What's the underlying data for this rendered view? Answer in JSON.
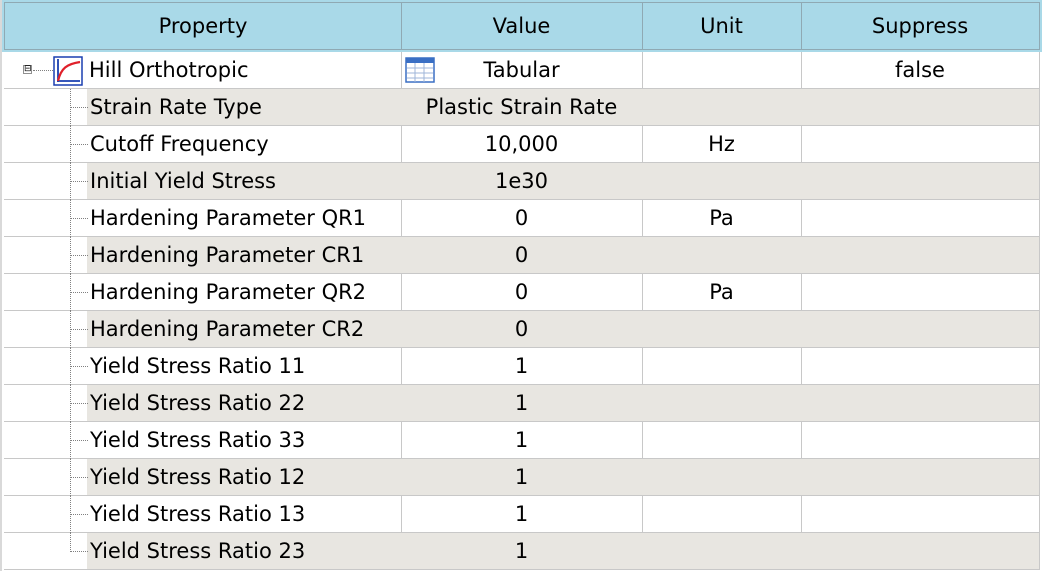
{
  "columns": [
    "Property",
    "Value",
    "Unit",
    "Suppress"
  ],
  "parent": {
    "property": "Hill Orthotropic",
    "value": "Tabular",
    "unit": "",
    "suppress": "false",
    "expander": "⊟"
  },
  "rows": [
    {
      "property": "Strain Rate Type",
      "value": "Plastic Strain Rate",
      "unit": ""
    },
    {
      "property": "Cutoff Frequency",
      "value": "10,000",
      "unit": "Hz"
    },
    {
      "property": "Initial Yield Stress",
      "value": "1e30",
      "unit": ""
    },
    {
      "property": "Hardening Parameter QR1",
      "value": "0",
      "unit": "Pa"
    },
    {
      "property": "Hardening Parameter CR1",
      "value": "0",
      "unit": ""
    },
    {
      "property": "Hardening Parameter QR2",
      "value": "0",
      "unit": "Pa"
    },
    {
      "property": "Hardening Parameter CR2",
      "value": "0",
      "unit": ""
    },
    {
      "property": "Yield Stress Ratio 11",
      "value": "1",
      "unit": ""
    },
    {
      "property": "Yield Stress Ratio 22",
      "value": "1",
      "unit": ""
    },
    {
      "property": "Yield Stress Ratio 33",
      "value": "1",
      "unit": ""
    },
    {
      "property": "Yield Stress Ratio 12",
      "value": "1",
      "unit": ""
    },
    {
      "property": "Yield Stress Ratio 13",
      "value": "1",
      "unit": ""
    },
    {
      "property": "Yield Stress Ratio 23",
      "value": "1",
      "unit": ""
    }
  ],
  "icons": {
    "material": "material-curve-icon",
    "tabular": "table-icon"
  },
  "colors": {
    "header_bg": "#a9d9e8",
    "shaded_row": "#e8e6e1",
    "curve_red": "#e0202a",
    "axis_blue": "#1a3fb0"
  }
}
